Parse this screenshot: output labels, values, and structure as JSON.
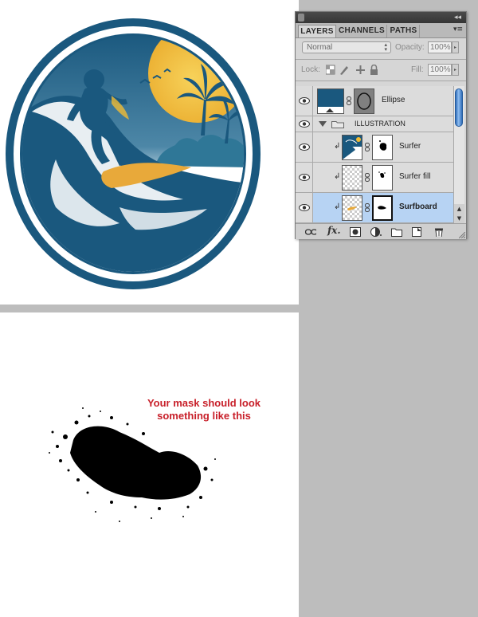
{
  "layers_panel": {
    "tabs": [
      {
        "label": "LAYERS",
        "active": true
      },
      {
        "label": "CHANNELS",
        "active": false
      },
      {
        "label": "PATHS",
        "active": false
      }
    ],
    "blend_mode": "Normal",
    "opacity_label": "Opacity:",
    "opacity_value": "100%",
    "lock_label": "Lock:",
    "fill_label": "Fill:",
    "fill_value": "100%",
    "layers": [
      {
        "name": "Ellipse",
        "type": "shape",
        "visible": true,
        "selected": false
      },
      {
        "name": "ILLUSTRATION",
        "type": "group",
        "visible": true,
        "selected": false
      },
      {
        "name": "Surfer",
        "type": "clipped-with-mask",
        "visible": true,
        "selected": false
      },
      {
        "name": "Surfer fill",
        "type": "clipped-with-mask",
        "visible": true,
        "selected": false
      },
      {
        "name": "Surfboard",
        "type": "clipped-with-mask",
        "visible": true,
        "selected": true
      }
    ],
    "bottom_icons": [
      "link-layers-icon",
      "fx-icon",
      "add-mask-icon",
      "adjustment-layer-icon",
      "new-group-icon",
      "new-layer-icon",
      "trash-icon"
    ]
  },
  "mask_note": {
    "line1": "Your mask should look",
    "line2": "something like this"
  },
  "colors": {
    "badge_blue": "#1a587e",
    "sun_yellow": "#f0bb34",
    "panel_grey": "#d6d6d6",
    "selected_row": "#b7d3f3",
    "note_red": "#c8202a",
    "backdrop_grey": "#bdbdbd"
  }
}
